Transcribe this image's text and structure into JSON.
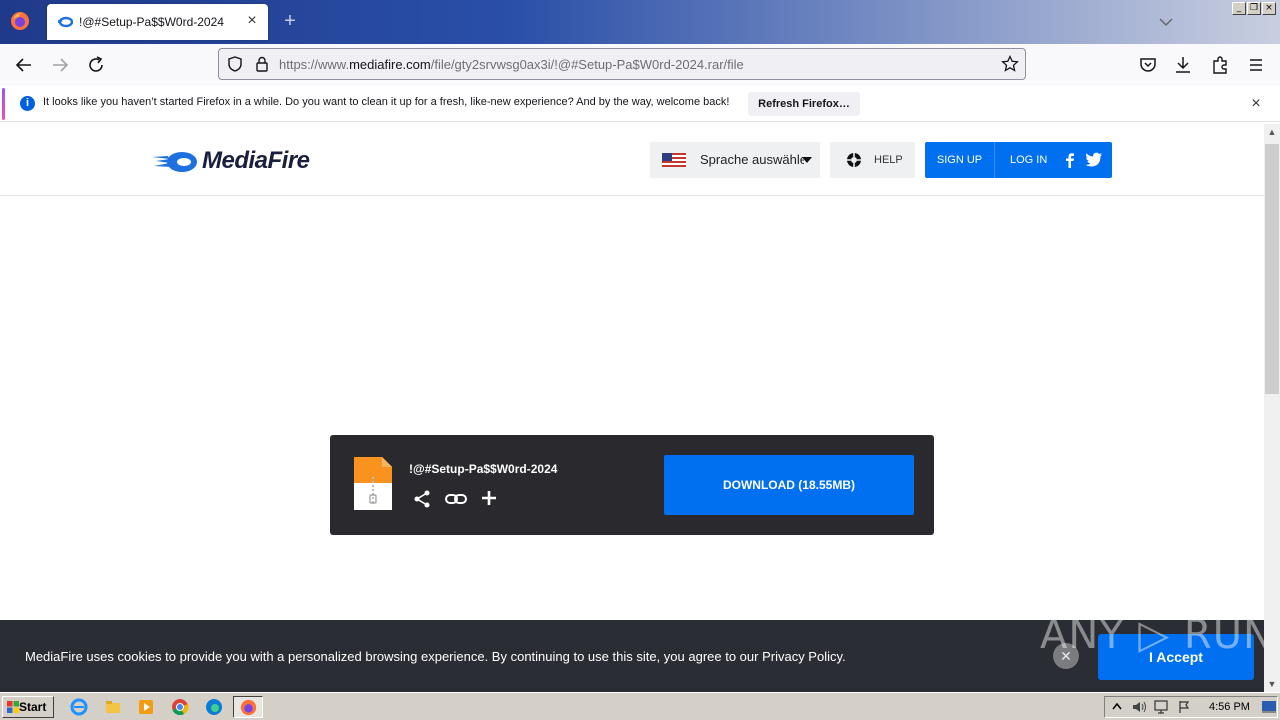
{
  "browser": {
    "tab_title": "!@#Setup-Pa$$W0rd-2024",
    "url_prefix": "https://www.",
    "url_host": "mediafire.com",
    "url_path": "/file/gty2srvwsg0ax3i/!@#Setup-Pa$W0rd-2024.rar/file",
    "notification_text": "It looks like you haven’t started Firefox in a while. Do you want to clean it up for a fresh, like-new experience? And by the way, welcome back!",
    "notification_button": "Refresh Firefox…"
  },
  "site": {
    "logo_text": "MediaFire",
    "language_label": "Sprache auswählen",
    "help_label": "HELP",
    "signup_label": "SIGN UP",
    "login_label": "LOG IN",
    "brand_color": "#0070f0"
  },
  "download": {
    "file_name": "!@#Setup-Pa$$W0rd-2024",
    "button_label": "DOWNLOAD (18.55MB)"
  },
  "cookie": {
    "text": "MediaFire uses cookies to provide you with a personalized browsing experience. By continuing to use this site, you agree to our Privacy Policy.",
    "accept_label": "I Accept",
    "close_symbol": "✕"
  },
  "watermark": "ANY ▷ RUN",
  "taskbar": {
    "start_label": "Start",
    "clock": "4:56 PM"
  }
}
